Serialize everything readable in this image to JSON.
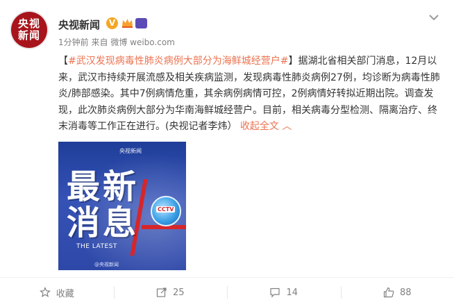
{
  "post": {
    "avatar_line1": "央视",
    "avatar_line2": "新闻",
    "author": "央视新闻",
    "verified_mark": "V",
    "time": "1分钟前",
    "source_prefix": "来自",
    "source": "微博 weibo.com",
    "topic": "#武汉发现病毒性肺炎病例大部分为海鲜城经营户#",
    "body": "据湖北省相关部门消息，12月以来，武汉市持续开展流感及相关疾病监测，发现病毒性肺炎病例27例，均诊断为病毒性肺炎/肺部感染。其中7例病情危重，其余病例病情可控，2例病情好转拟近期出院。调查发现，此次肺炎病例大部分为华南海鲜城经营户。目前，相关病毒分型检测、隔离治疗、终末消毒等工作正在进行。(央视记者李炜）",
    "collapse_label": "收起全文",
    "image": {
      "top_mark": "央视新闻",
      "line1": "最新",
      "line2": "消息",
      "subtitle": "THE LATEST",
      "logo": "CCTV",
      "watermark": "@央视新闻"
    }
  },
  "actions": {
    "favorite": "收藏",
    "repost": "25",
    "comment": "14",
    "like": "88"
  },
  "colors": {
    "accent": "#eb7350",
    "brand_red": "#a8141b"
  }
}
